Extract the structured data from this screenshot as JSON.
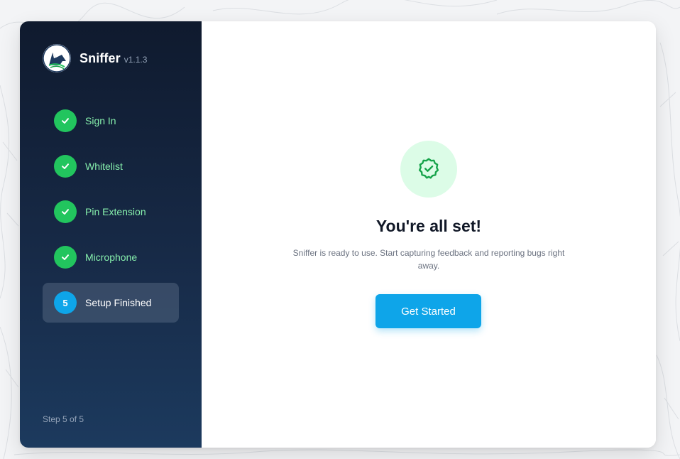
{
  "app": {
    "name": "Sniffer",
    "version": "v1.1.3",
    "logo_icon": "wolf-logo-icon"
  },
  "sidebar": {
    "steps": [
      {
        "label": "Sign In",
        "status": "done",
        "icon": "check-icon"
      },
      {
        "label": "Whitelist",
        "status": "done",
        "icon": "check-icon"
      },
      {
        "label": "Pin Extension",
        "status": "done",
        "icon": "check-icon"
      },
      {
        "label": "Microphone",
        "status": "done",
        "icon": "check-icon"
      },
      {
        "label": "Setup Finished",
        "status": "current",
        "number": "5"
      }
    ],
    "progress_text": "Step 5 of 5"
  },
  "main": {
    "badge_icon": "badge-check-icon",
    "title": "You're all set!",
    "subtitle": "Sniffer is ready to use. Start capturing feedback and reporting bugs right away.",
    "cta_label": "Get Started"
  },
  "colors": {
    "accent": "#0ea5e9",
    "success": "#22c55e",
    "success_light": "#dcfce7",
    "sidebar_top": "#0f1a2e",
    "sidebar_bottom": "#1c3a5e"
  }
}
